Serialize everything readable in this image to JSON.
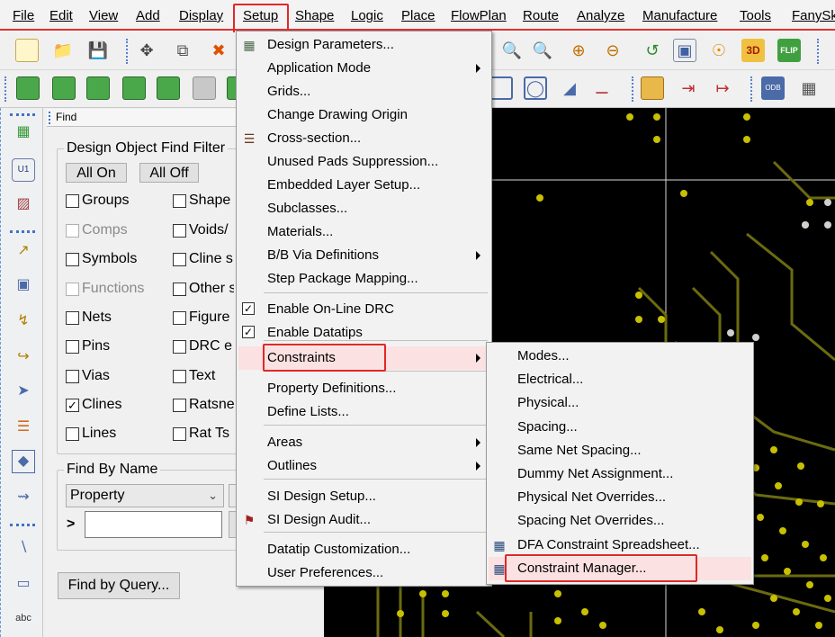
{
  "menubar": [
    "File",
    "Edit",
    "View",
    "Add",
    "Display",
    "Setup",
    "Shape",
    "Logic",
    "Place",
    "FlowPlan",
    "Route",
    "Analyze",
    "Manufacture",
    "Tools",
    "FanySk"
  ],
  "find_panel": {
    "title": "Find",
    "filter_title": "Design Object Find Filter",
    "all_on": "All On",
    "all_off": "All Off",
    "left_items": [
      {
        "label": "Groups",
        "checked": false,
        "enabled": true
      },
      {
        "label": "Comps",
        "checked": false,
        "enabled": false
      },
      {
        "label": "Symbols",
        "checked": false,
        "enabled": true
      },
      {
        "label": "Functions",
        "checked": false,
        "enabled": false
      },
      {
        "label": "Nets",
        "checked": false,
        "enabled": true
      },
      {
        "label": "Pins",
        "checked": false,
        "enabled": true
      },
      {
        "label": "Vias",
        "checked": false,
        "enabled": true
      },
      {
        "label": "Clines",
        "checked": true,
        "enabled": true
      },
      {
        "label": "Lines",
        "checked": false,
        "enabled": true
      }
    ],
    "right_items": [
      {
        "label": "Shape",
        "checked": false
      },
      {
        "label": "Voids/",
        "checked": false
      },
      {
        "label": "Cline s",
        "checked": false
      },
      {
        "label": "Other s",
        "checked": false
      },
      {
        "label": "Figure",
        "checked": false
      },
      {
        "label": "DRC e",
        "checked": false
      },
      {
        "label": "Text",
        "checked": false
      },
      {
        "label": "Ratsne",
        "checked": false
      },
      {
        "label": "Rat Ts",
        "checked": false
      }
    ],
    "find_by_name_title": "Find By Name",
    "find_by_name_value": "Property",
    "name_prefix": ">",
    "name_input_value": "",
    "find_by_query": "Find by Query..."
  },
  "setup_menu": {
    "items": [
      {
        "label": "Design Parameters...",
        "icon": "design-parameters-icon"
      },
      {
        "label": "Application Mode",
        "submenu": true
      },
      {
        "label": "Grids..."
      },
      {
        "label": "Change Drawing Origin"
      },
      {
        "label": "Cross-section...",
        "icon": "cross-section-icon"
      },
      {
        "label": "Unused Pads Suppression..."
      },
      {
        "label": "Embedded Layer Setup..."
      },
      {
        "label": "Subclasses..."
      },
      {
        "label": "Materials..."
      },
      {
        "label": "B/B Via Definitions",
        "submenu": true
      },
      {
        "label": "Step Package Mapping..."
      },
      {
        "label": "Enable On-Line DRC",
        "checked": true
      },
      {
        "label": "Enable Datatips",
        "checked": true
      },
      {
        "label": "Constraints",
        "submenu": true,
        "highlighted": true
      },
      {
        "label": "Property Definitions..."
      },
      {
        "label": "Define Lists..."
      },
      {
        "label": "Areas",
        "submenu": true
      },
      {
        "label": "Outlines",
        "submenu": true
      },
      {
        "label": "SI Design Setup..."
      },
      {
        "label": "SI Design Audit...",
        "icon": "si-design-audit-icon"
      },
      {
        "label": "Datatip Customization..."
      },
      {
        "label": "User Preferences..."
      }
    ]
  },
  "constraints_menu": {
    "items": [
      {
        "label": "Modes..."
      },
      {
        "label": "Electrical..."
      },
      {
        "label": "Physical..."
      },
      {
        "label": "Spacing..."
      },
      {
        "label": "Same Net Spacing..."
      },
      {
        "label": "Dummy Net Assignment..."
      },
      {
        "label": "Physical Net Overrides..."
      },
      {
        "label": "Spacing Net Overrides..."
      },
      {
        "label": "DFA Constraint Spreadsheet...",
        "icon": "spreadsheet-icon"
      },
      {
        "label": "Constraint Manager...",
        "icon": "constraint-manager-icon",
        "highlighted": true
      }
    ]
  },
  "colors": {
    "highlight_box": "#e02828",
    "menu_hover": "#fbe1e1",
    "canvas": "#000000",
    "trace": "#6b6b10",
    "pad": "#c8c000"
  }
}
